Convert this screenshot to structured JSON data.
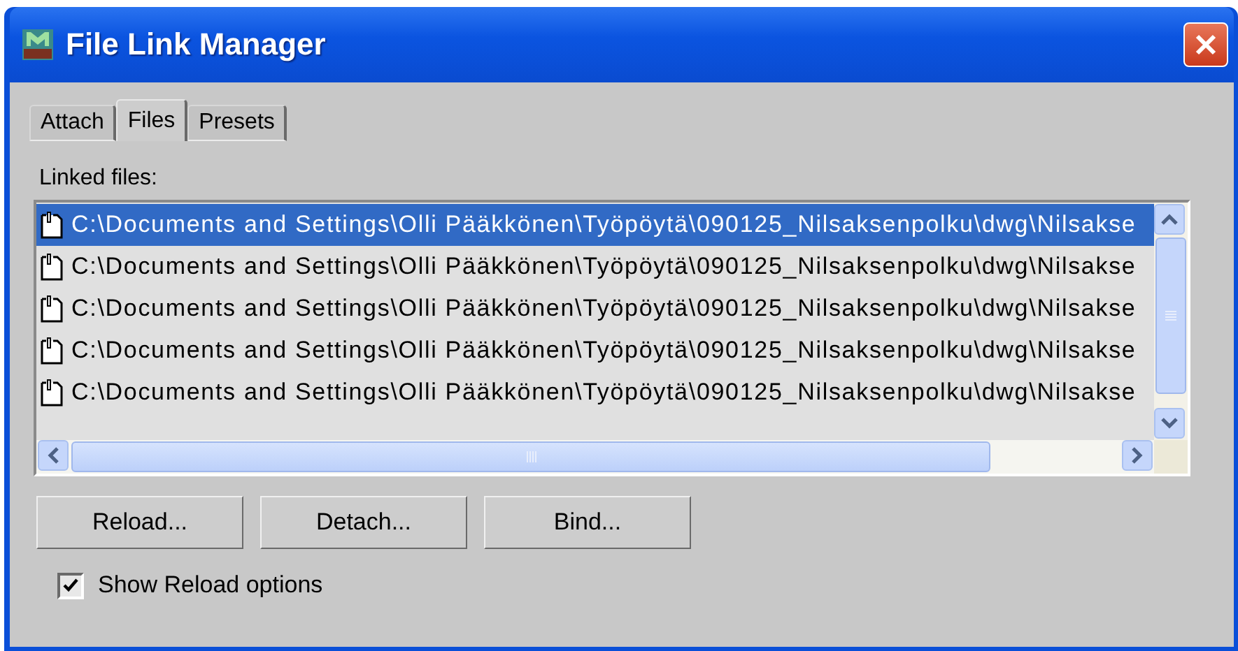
{
  "window": {
    "title": "File Link Manager"
  },
  "tabs": [
    {
      "label": "Attach",
      "selected": false
    },
    {
      "label": "Files",
      "selected": true
    },
    {
      "label": "Presets",
      "selected": false
    }
  ],
  "linked_files": {
    "label": "Linked files:",
    "rows": [
      {
        "path": "C:\\Documents and Settings\\Olli Pääkkönen\\Työpöytä\\090125_Nilsaksenpolku\\dwg\\Nilsakse",
        "selected": true
      },
      {
        "path": "C:\\Documents and Settings\\Olli Pääkkönen\\Työpöytä\\090125_Nilsaksenpolku\\dwg\\Nilsakse",
        "selected": false
      },
      {
        "path": "C:\\Documents and Settings\\Olli Pääkkönen\\Työpöytä\\090125_Nilsaksenpolku\\dwg\\Nilsakse",
        "selected": false
      },
      {
        "path": "C:\\Documents and Settings\\Olli Pääkkönen\\Työpöytä\\090125_Nilsaksenpolku\\dwg\\Nilsakse",
        "selected": false
      },
      {
        "path": "C:\\Documents and Settings\\Olli Pääkkönen\\Työpöytä\\090125_Nilsaksenpolku\\dwg\\Nilsakse",
        "selected": false
      }
    ]
  },
  "buttons": [
    "Reload...",
    "Detach...",
    "Bind..."
  ],
  "show_reload_options": {
    "label": "Show Reload options",
    "checked": true
  }
}
